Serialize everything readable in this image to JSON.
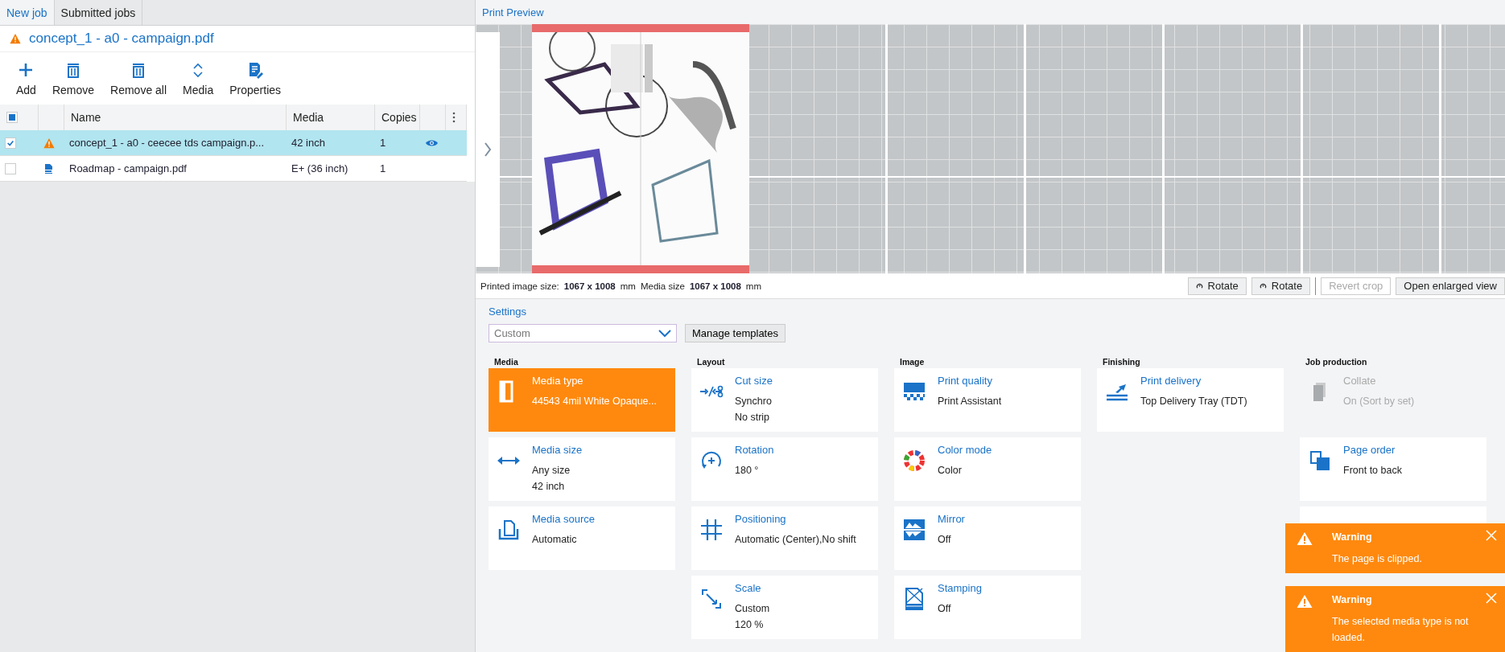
{
  "tabs": [
    {
      "label": "New job",
      "selected": true
    },
    {
      "label": "Submitted jobs",
      "selected": false
    }
  ],
  "job_title": {
    "text": "concept_1 - a0 - campaign.pdf",
    "warning": true
  },
  "toolbar": [
    {
      "label": "Add",
      "kind": "add"
    },
    {
      "label": "Remove",
      "kind": "trash"
    },
    {
      "label": "Remove all",
      "kind": "trash"
    },
    {
      "label": "Media",
      "kind": "updown"
    },
    {
      "label": "Properties",
      "kind": "properties"
    }
  ],
  "table": {
    "select_all_indeterminate": true,
    "columns": [
      "Name",
      "Media",
      "Copies"
    ],
    "rows": [
      {
        "checked": true,
        "selected": true,
        "kind": "warning",
        "name": "concept_1 - a0 - ceecee tds campaign.p...",
        "media": "42 inch",
        "copies": "1",
        "previewed": true
      },
      {
        "checked": false,
        "selected": false,
        "kind": "pdf",
        "name": "Roadmap - campaign.pdf",
        "media": "E+ (36 inch)",
        "copies": "1"
      }
    ]
  },
  "preview": {
    "title": "Print Preview",
    "info": [
      {
        "label": "Printed image size:",
        "value": "1067 x 1008",
        "unit": "mm"
      },
      {
        "label": "Media size",
        "value": "1067 x 1008",
        "unit": "mm"
      }
    ],
    "buttons": [
      {
        "label": "Rotate",
        "kind": "rotate",
        "disabled": false
      },
      {
        "label": "Rotate",
        "kind": "rotate",
        "disabled": false
      },
      {
        "label": "Revert crop",
        "kind": "plain",
        "disabled": true
      },
      {
        "label": "Open enlarged view",
        "kind": "plain",
        "disabled": false
      }
    ]
  },
  "settings": {
    "title": "Settings",
    "template": "Custom",
    "manage_button": "Manage templates",
    "columns": [
      {
        "title": "Media",
        "cards": [
          {
            "kind": "media-type",
            "title": "Media type",
            "values": [
              "44543 4mil White Opaque..."
            ],
            "highlighted": true
          },
          {
            "kind": "media-size",
            "title": "Media size",
            "values": [
              "Any size",
              "42 inch"
            ]
          },
          {
            "kind": "media-source",
            "title": "Media source",
            "values": [
              "Automatic"
            ]
          }
        ]
      },
      {
        "title": "Layout",
        "cards": [
          {
            "kind": "cut-size",
            "title": "Cut size",
            "values": [
              "Synchro",
              "No strip"
            ]
          },
          {
            "kind": "rotation",
            "title": "Rotation",
            "values": [
              "180 °"
            ]
          },
          {
            "kind": "positioning",
            "title": "Positioning",
            "values": [
              "Automatic (Center),No shift"
            ]
          },
          {
            "kind": "scale",
            "title": "Scale",
            "values": [
              "Custom",
              "120 %"
            ]
          }
        ]
      },
      {
        "title": "Image",
        "cards": [
          {
            "kind": "print-quality",
            "title": "Print quality",
            "values": [
              "Print Assistant"
            ]
          },
          {
            "kind": "color-mode",
            "title": "Color mode",
            "values": [
              "Color"
            ]
          },
          {
            "kind": "mirror",
            "title": "Mirror",
            "values": [
              "Off"
            ]
          },
          {
            "kind": "stamping",
            "title": "Stamping",
            "values": [
              "Off"
            ]
          }
        ]
      },
      {
        "title": "Finishing",
        "cards": [
          {
            "kind": "print-delivery",
            "title": "Print delivery",
            "values": [
              "Top Delivery Tray (TDT)"
            ]
          }
        ]
      },
      {
        "title": "Job production",
        "cards": [
          {
            "kind": "collate",
            "title": "Collate",
            "values": [
              "On (Sort by set)"
            ],
            "disabled": true
          },
          {
            "kind": "page-order",
            "title": "Page order",
            "values": [
              "Front to back"
            ]
          },
          {
            "kind": "hidden"
          }
        ]
      }
    ]
  },
  "toasts": [
    {
      "title": "Warning",
      "message": "The page is clipped."
    },
    {
      "title": "Warning",
      "message": "The selected media type is not loaded."
    }
  ]
}
